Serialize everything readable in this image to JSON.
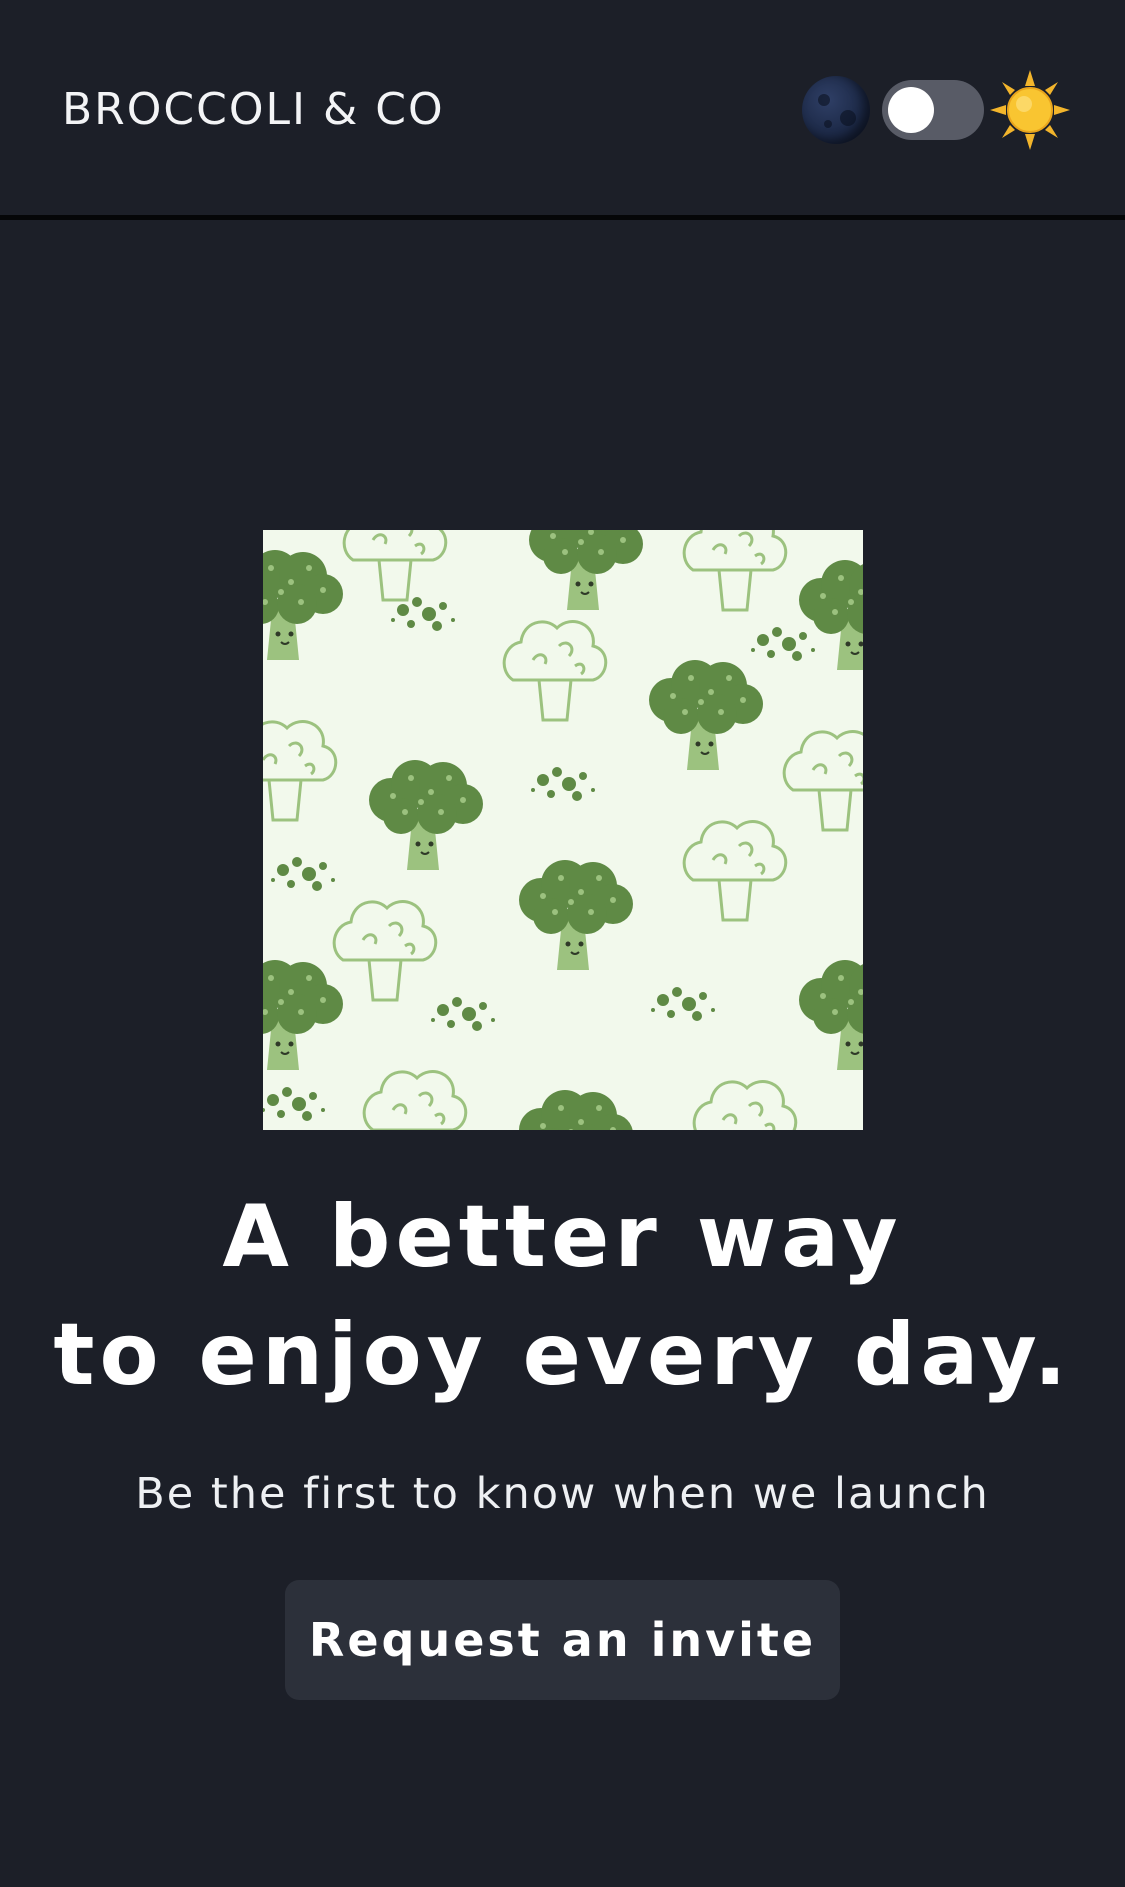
{
  "header": {
    "brand": "BROCCOLI & CO",
    "theme_toggle": {
      "left_icon": "moon-icon",
      "right_icon": "sun-icon",
      "state": "off"
    }
  },
  "hero": {
    "image_icon": "broccoli-pattern-illustration",
    "headline_line1": "A better way",
    "headline_line2": "to enjoy every day.",
    "subheadline": "Be the first to know when we launch",
    "cta_label": "Request an invite"
  },
  "colors": {
    "background": "#1c1f28",
    "header_border": "#050608",
    "button_bg": "#2c303a",
    "toggle_track": "#585b66",
    "illustration_bg": "#f2f9ec",
    "broccoli_dark": "#5f8a45",
    "broccoli_light": "#9cc27f"
  }
}
